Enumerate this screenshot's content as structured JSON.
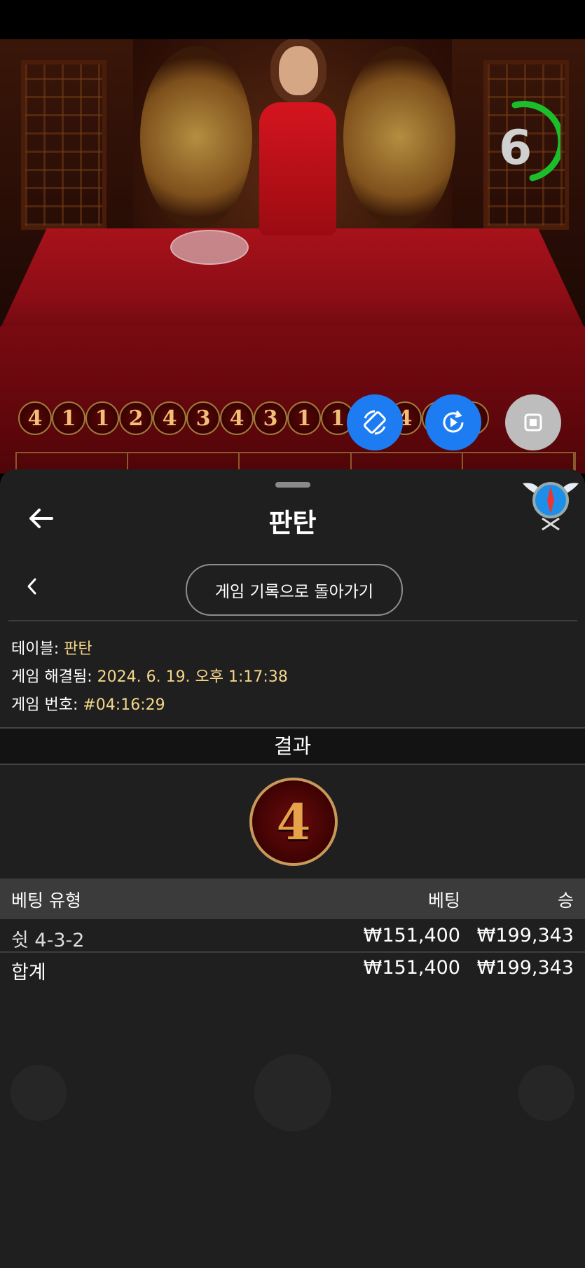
{
  "video": {
    "timer_value": "6",
    "timer_color": "#1bbd2b",
    "road_results": [
      "4",
      "1",
      "1",
      "2",
      "4",
      "3",
      "4",
      "3",
      "1",
      "1",
      "4",
      "4",
      "1",
      "3"
    ],
    "buttons": [
      {
        "name": "rotate-icon",
        "color": "#1e7cf2"
      },
      {
        "name": "replay-icon",
        "color": "#1e7cf2"
      },
      {
        "name": "stop-icon",
        "color": "#bdbdbd"
      }
    ]
  },
  "sheet": {
    "title": "판탄",
    "back_to_history": "게임 기록으로 돌아가기",
    "info": {
      "table_label": "테이블: ",
      "table_value": "판탄",
      "resolved_label": "게임 해결됨: ",
      "resolved_value": "2024. 6. 19. 오후 1:17:38",
      "number_label": "게임 번호: ",
      "number_value": "#04:16:29"
    },
    "result_label": "결과",
    "result_value": "4",
    "table_header": {
      "bet_type": "베팅 유형",
      "bet": "베팅",
      "win": "승"
    },
    "rows": [
      {
        "type": "쉿 4-3-2",
        "bet": "₩151,400",
        "win": "₩199,343"
      }
    ],
    "total": {
      "label": "합계",
      "bet": "₩151,400",
      "win": "₩199,343"
    }
  }
}
